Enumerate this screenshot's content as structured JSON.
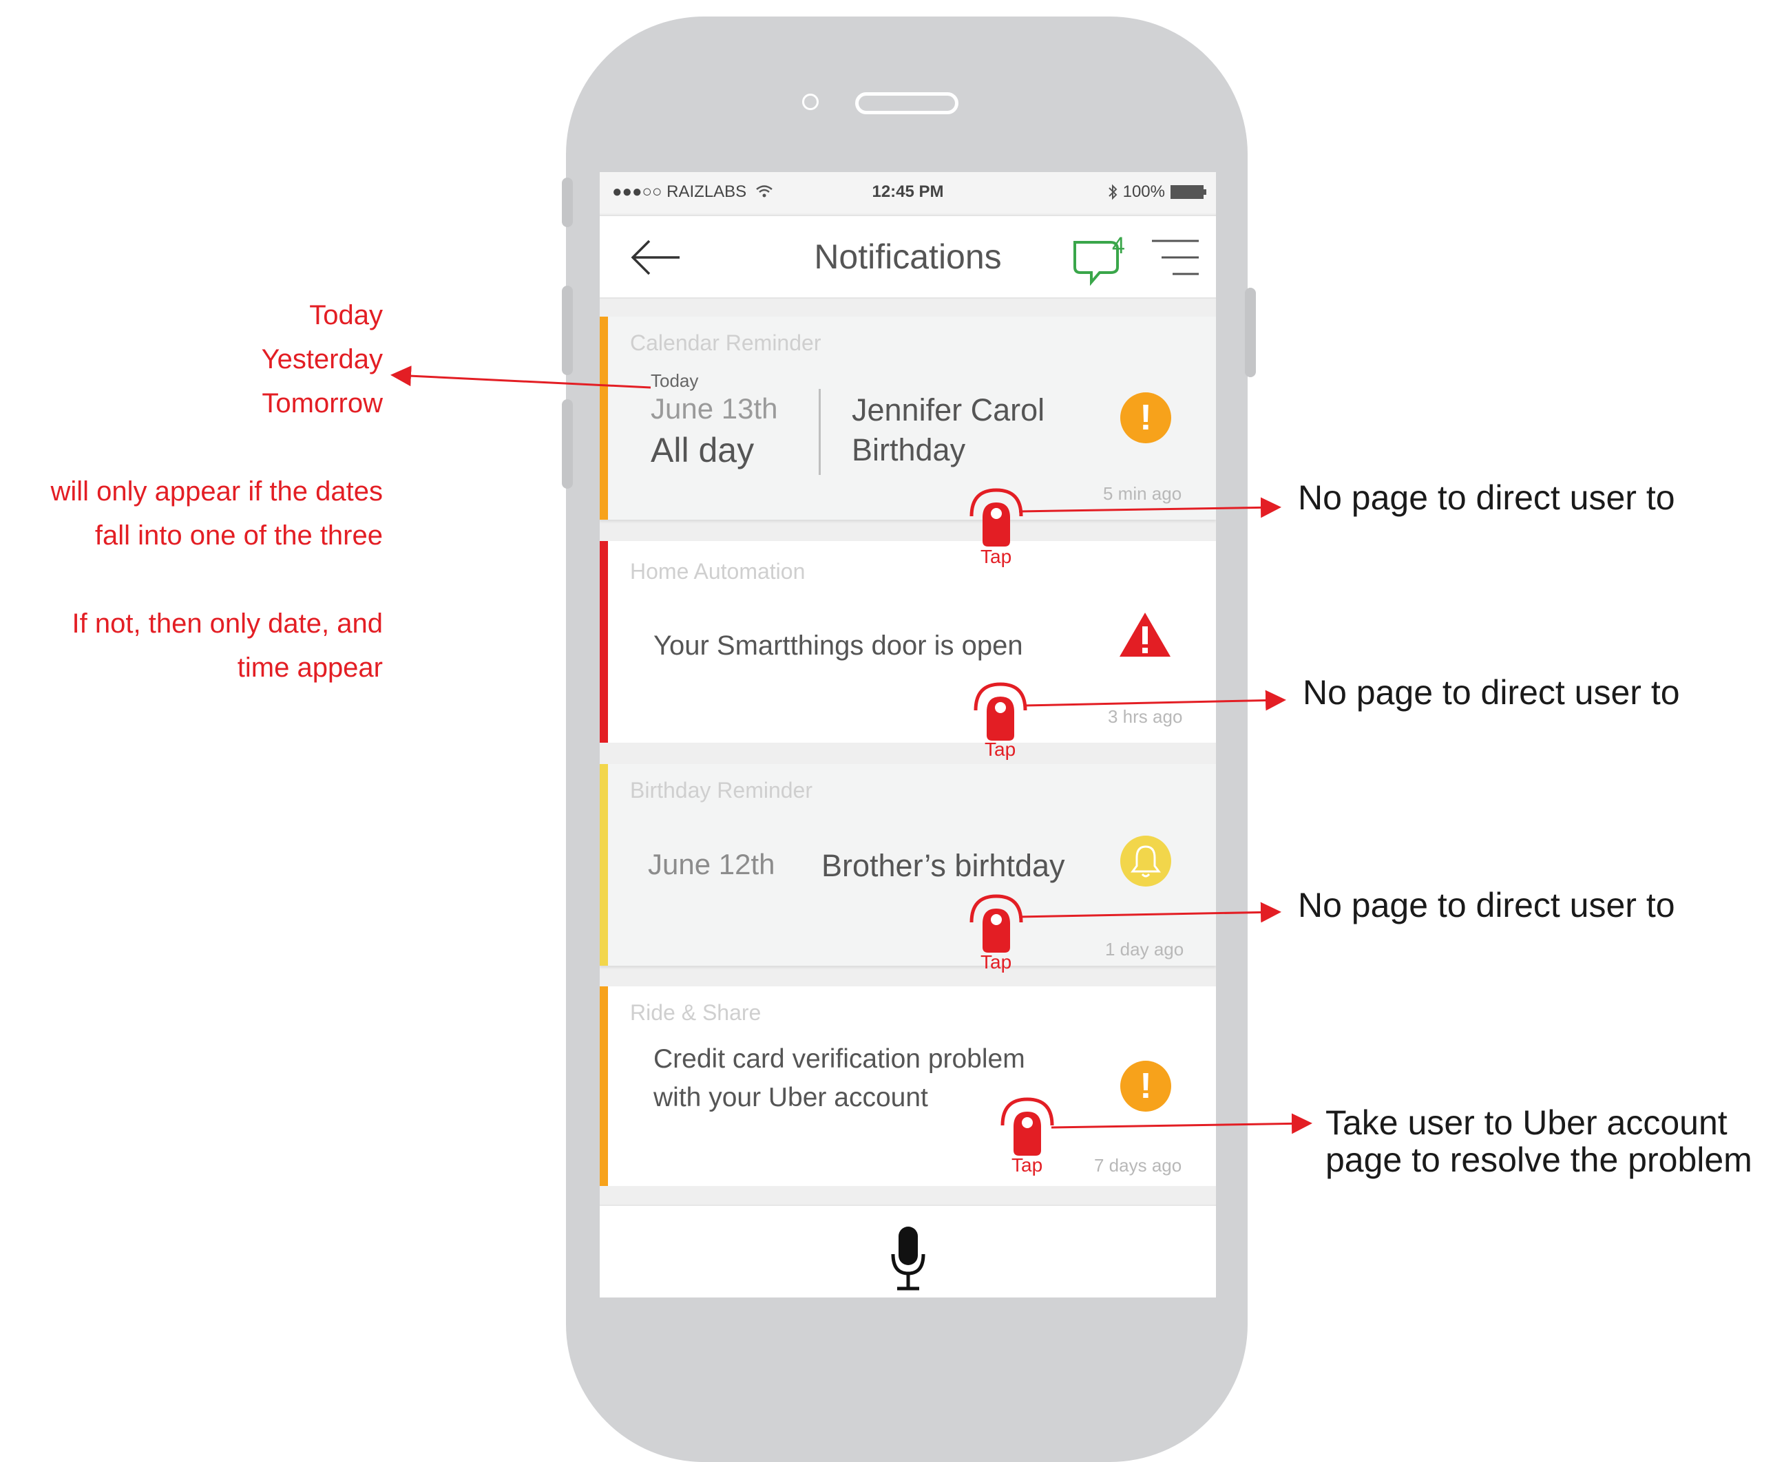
{
  "status_bar": {
    "carrier": "●●●○○ RAIZLABS",
    "time": "12:45 PM",
    "battery": "100%"
  },
  "nav": {
    "title": "Notifications",
    "badge_count": "4",
    "back_icon": "back-arrow-icon",
    "menu_icon": "hamburger-menu-icon"
  },
  "cards": [
    {
      "category": "Calendar Reminder",
      "relative_day": "Today",
      "date": "June 13th",
      "time": "All day",
      "title_line1": "Jennifer Carol",
      "title_line2": "Birthday",
      "ago": "5 min ago",
      "stripe_color": "#f7a21b",
      "icon": "alert-circle-icon",
      "icon_color": "#f7a21b"
    },
    {
      "category": "Home Automation",
      "message": "Your Smartthings door is open",
      "ago": "3 hrs ago",
      "stripe_color": "#e31e24",
      "icon": "warning-triangle-icon",
      "icon_color": "#e31e24"
    },
    {
      "category": "Birthday Reminder",
      "date": "June 12th",
      "message": "Brother’s birhtday",
      "ago": "1 day ago",
      "stripe_color": "#f2d64b",
      "icon": "bell-icon",
      "icon_color": "#f2d64b"
    },
    {
      "category": "Ride & Share",
      "message_line1": "Credit card verification problem",
      "message_line2": "with your Uber account",
      "ago": "7 days ago",
      "stripe_color": "#f7a21b",
      "icon": "alert-circle-icon",
      "icon_color": "#f7a21b"
    }
  ],
  "bottom_bar": {
    "icon": "microphone-icon"
  },
  "annotations": {
    "left_days": [
      "Today",
      "Yesterday",
      "Tomorrow"
    ],
    "left_note_1a": "will only appear if the dates",
    "left_note_1b": "fall into one of the three",
    "left_note_2a": "If not, then only date, and",
    "left_note_2b": "time appear",
    "tap_label": "Tap",
    "right_1": "No page to direct user to",
    "right_2": "No page to direct user to",
    "right_3": "No page to direct user to",
    "right_4a": "Take user to Uber account",
    "right_4b": "page to resolve the problem"
  },
  "colors": {
    "annotation_red": "#e31e24",
    "phone_body": "#d1d2d4",
    "chat_green": "#3aa64a"
  }
}
